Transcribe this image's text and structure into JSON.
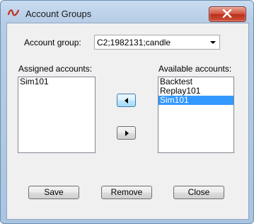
{
  "window": {
    "title": "Account Groups",
    "close_label": "Close window"
  },
  "account_group": {
    "label": "Account group:",
    "value": "C2;1982131;candle"
  },
  "assigned": {
    "label": "Assigned accounts:",
    "items": [
      "Sim101"
    ]
  },
  "available": {
    "label": "Available accounts:",
    "items": [
      "Backtest",
      "Replay101",
      "Sim101"
    ],
    "selected": "Sim101"
  },
  "buttons": {
    "save": "Save",
    "remove": "Remove",
    "close": "Close"
  },
  "icons": {
    "app": "app-logo-icon",
    "move_left": "arrow-left-icon",
    "move_right": "arrow-right-icon",
    "close": "close-x-icon"
  },
  "colors": {
    "selection": "#3399ff",
    "close_button": "#c7402c"
  }
}
